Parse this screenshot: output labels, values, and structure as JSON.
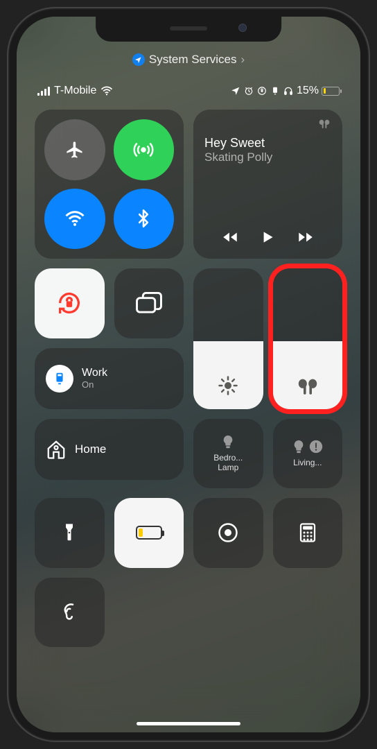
{
  "top_link": {
    "label": "System Services"
  },
  "status": {
    "carrier": "T-Mobile",
    "battery_pct": "15%"
  },
  "media": {
    "title": "Hey Sweet",
    "artist": "Skating Polly"
  },
  "focus": {
    "title": "Work",
    "state": "On"
  },
  "home": {
    "label": "Home"
  },
  "accessories": {
    "a1": "Bedro...\nLamp",
    "a2": "Living..."
  },
  "sliders": {
    "brightness_fill": 48,
    "volume_fill": 48
  }
}
